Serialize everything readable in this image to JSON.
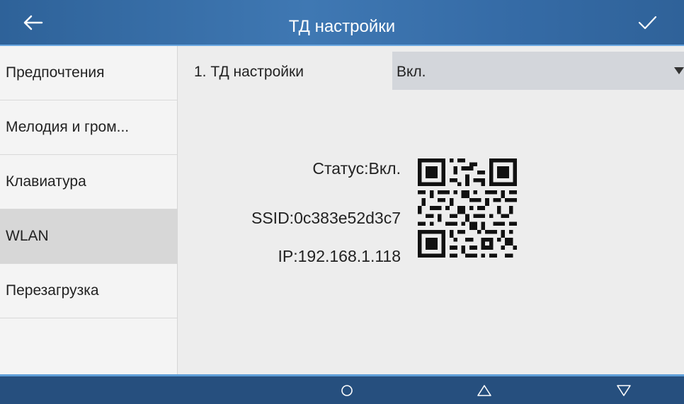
{
  "header": {
    "title": "ТД настройки",
    "back_icon": "arrow-left-icon",
    "confirm_icon": "check-icon"
  },
  "sidebar": {
    "items": [
      {
        "label": "Предпочтения"
      },
      {
        "label": "Мелодия и гром..."
      },
      {
        "label": "Клавиатура"
      },
      {
        "label": "WLAN"
      },
      {
        "label": "Перезагрузка"
      }
    ],
    "active": "WLAN"
  },
  "settings": {
    "label": "1.  ТД настройки",
    "value": "Вкл."
  },
  "status": {
    "status_text": "Статус:Вкл.",
    "ssid_text": "SSID:0c383e52d3c7",
    "ip_text": "IP:192.168.1.118"
  },
  "navbar": {
    "buttons": [
      "circle-icon",
      "triangle-up-icon",
      "triangle-down-icon"
    ]
  },
  "colors": {
    "header": "#356ba6",
    "navbar": "#264f7e",
    "select_bg": "#d3d6db",
    "active_item": "#d7d7d7"
  }
}
